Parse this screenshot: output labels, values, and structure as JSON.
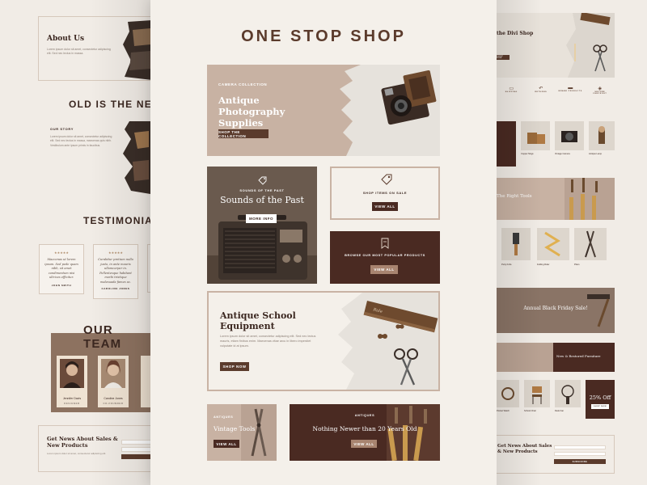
{
  "left_page": {
    "about_title": "About Us",
    "about_text": "Lorem ipsum dolor sit amet, consectetur adipiscing elit. Sed nec lectus in massa.",
    "heading": "OLD IS THE NEW N",
    "story_label": "OUR STORY",
    "story_text": "Lorem ipsum dolor sit amet, consectetur adipiscing elit. Sed nec lectus in massa, maecenas quis nibh. Vestibulum ante ipsum primis in faucibus.",
    "testimonials_heading": "TESTIMONIALS",
    "testimonials": [
      {
        "stars": "★★★★★",
        "quote": "Maecenas ut lorem ipsum. Sed pede quam nibh, sit amet condimentum nisi ultrices efficitur.",
        "name": "JOHN SMITH"
      },
      {
        "stars": "★★★★★",
        "quote": "Curabitur pretium nulla justo, in ante mauris ullamcorper in. Pellentesque habitant morbi tristique malesuada fames ac.",
        "name": "CAROLINE JONES"
      }
    ],
    "team_heading": "OUR TEAM",
    "team": [
      {
        "name": "Jennifer Davis",
        "role": "DESIGNER"
      },
      {
        "name": "Caroline Jones",
        "role": "CO-FOUNDER"
      }
    ],
    "newsletter_title": "Get News About Sales & New Products",
    "newsletter_text": "Lorem ipsum dolor sit amet, consectetur adipiscing elit."
  },
  "main_page": {
    "title": "ONE STOP SHOP",
    "hero": {
      "eyebrow": "CAMERA COLLECTION",
      "title": "Antique Photography Supplies",
      "button": "SHOP THE COLLECTION"
    },
    "radio_card": {
      "eyebrow": "SOUNDS OF THE PAST",
      "title": "Sounds of the Past",
      "button": "MORE INFO"
    },
    "sale_card": {
      "label": "SHOP ITEMS ON SALE",
      "button": "VIEW ALL"
    },
    "popular_card": {
      "label": "BROWSE OUR MOST POPULAR PRODUCTS",
      "button": "VIEW ALL"
    },
    "school_card": {
      "title": "Antique School Equipment",
      "text": "Lorem ipsum dolor sit amet, consectetur adipiscing elit. Sed nec lectus mauris, etiam finibus enim. Maecenas vitae arcu in libero imperdiet vulputate id at ipsum.",
      "button": "SHOP NOW"
    },
    "tools_card": {
      "eyebrow": "ANTIQUES",
      "title": "Vintage Tools",
      "button": "VIEW ALL"
    },
    "newer_card": {
      "eyebrow": "ANTIQUES",
      "title": "Nothing Newer than 20 Years Old",
      "button": "VIEW ALL"
    }
  },
  "right_page": {
    "hero_title": "the Divi Shop",
    "hero_button": "SHOP NOW",
    "features": [
      "SHIPPING",
      "RETURNS",
      "BRAND PRODUCTS",
      "SECURE CHECKOUT"
    ],
    "products_row1": [
      "Copper Mugs",
      "Vintage Camera",
      "Antique Lamp"
    ],
    "tools_banner": "The Right Tools",
    "products_row2": [
      "Putty Knife",
      "Folding Ruler",
      "Pliers"
    ],
    "sale_title": "Annual Black Friday Sale!",
    "restored_title": "New & Restored Furniture",
    "products_row3": [
      "Pocket Watch",
      "School Chair",
      "Desk Fan"
    ],
    "discount_label": "25% Off",
    "discount_button": "SHOP NOW",
    "newsletter_title": "Get News About Sales & New Products",
    "subscribe": "SUBSCRIBE"
  },
  "colors": {
    "dark_brown": "#4a2a22",
    "tan": "#c9b3a4",
    "accent": "#5b3b2c",
    "paper": "#f4f0ea"
  }
}
